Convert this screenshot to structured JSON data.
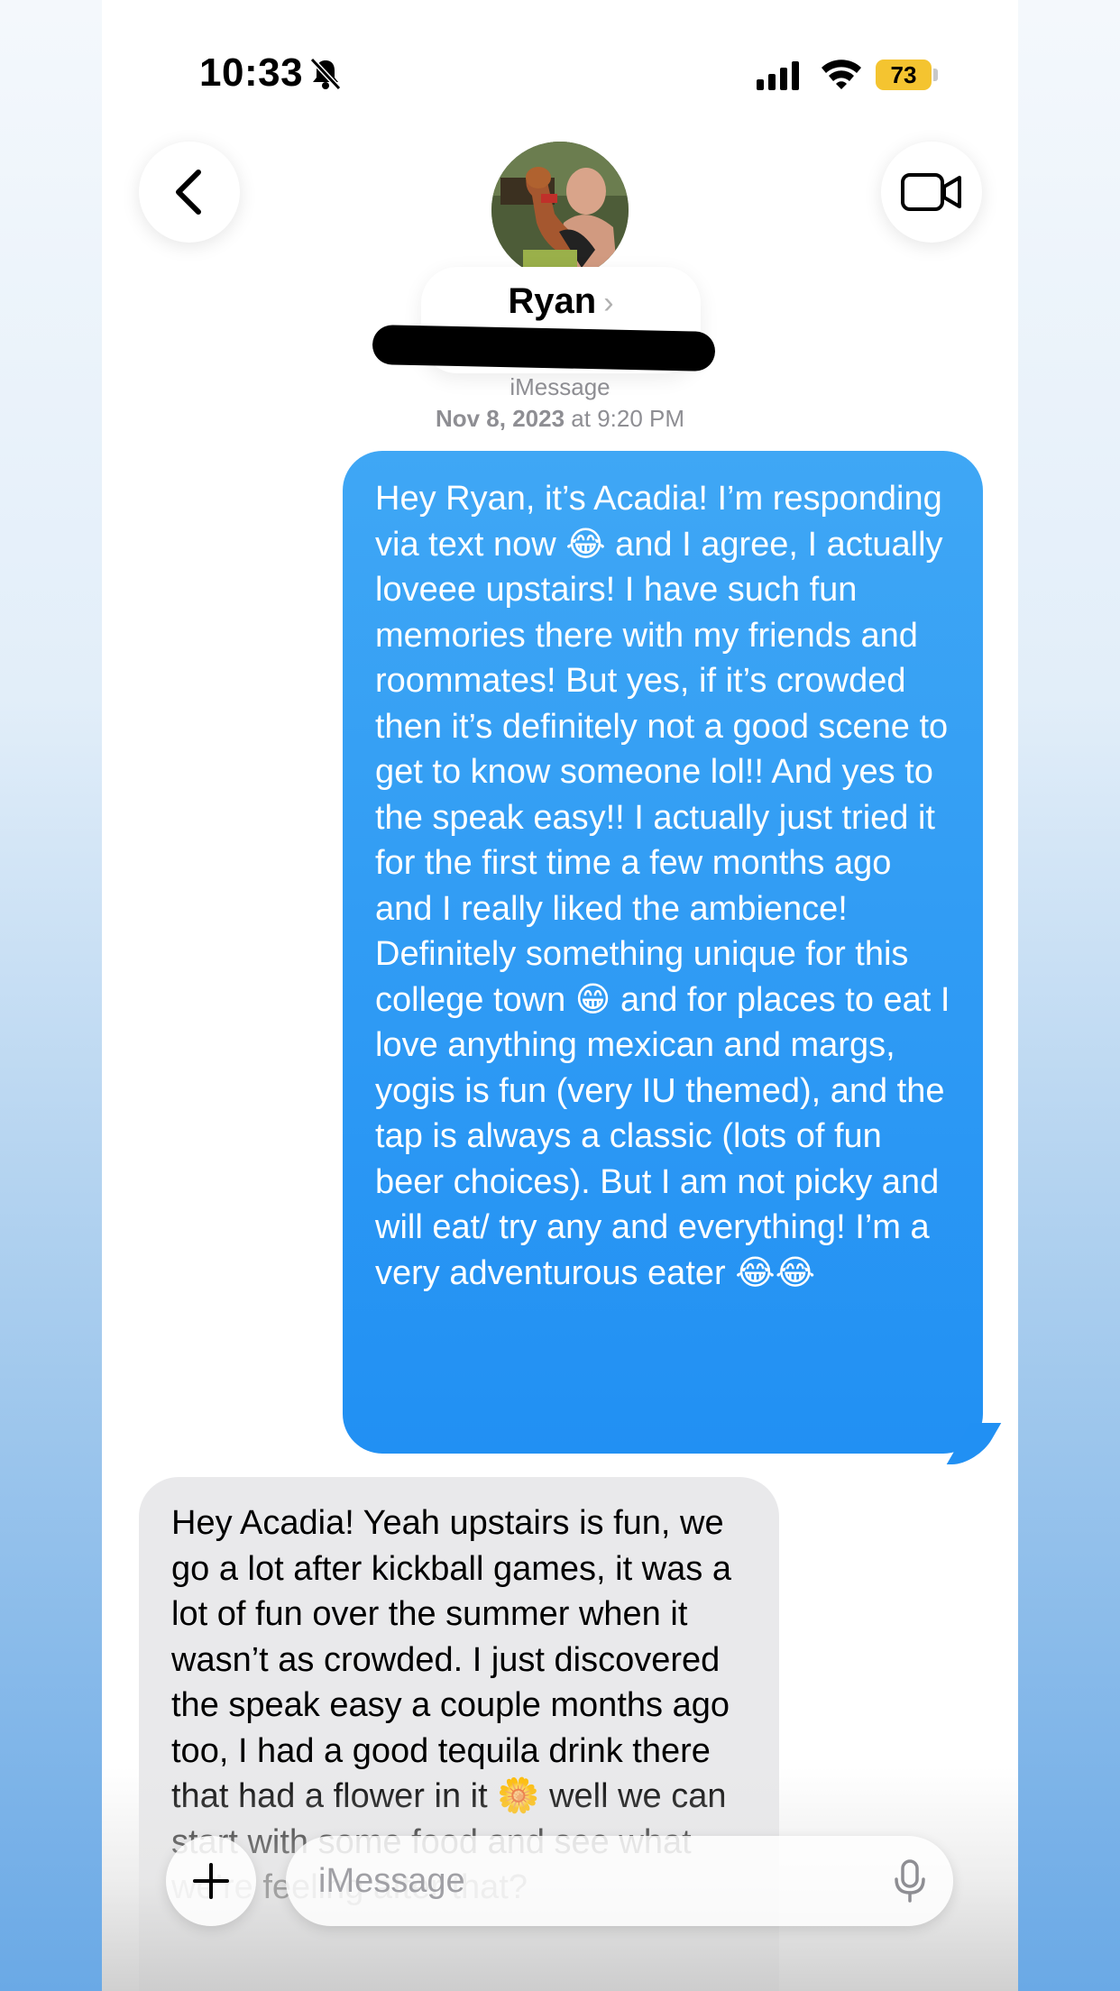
{
  "status_bar": {
    "time": "10:33",
    "battery": "73",
    "icons": [
      "bell-slash-icon",
      "cellular-signal-icon",
      "wifi-icon",
      "battery-icon"
    ]
  },
  "header": {
    "back_icon": "chevron-left-icon",
    "video_icon": "video-camera-icon",
    "contact_name": "Ryan",
    "contact_chevron": "›",
    "service": "iMessage",
    "date": "Nov 8, 2023",
    "time_prefix": " at ",
    "time": "9:20 PM"
  },
  "messages": [
    {
      "direction": "outgoing",
      "text": "Hey Ryan, it’s Acadia! I’m responding via text now 😂 and I agree, I actually loveee upstairs! I have such fun memories there with my friends and roommates! But yes, if it’s crowded then it’s definitely not a good scene to get to know someone lol!! And yes to the speak easy!! I actually just tried it for the first time a few months ago and I really liked the ambience! Definitely something unique for this college town 😁 and for places to eat I love anything mexican and margs, yogis is fun (very IU themed), and the tap is always a classic (lots of fun beer choices). But I am not picky and will eat/ try any and everything! I’m a very adventurous eater 😂😂"
    },
    {
      "direction": "incoming",
      "text": "Hey Acadia! Yeah upstairs is fun, we go a lot after kickball games, it was a lot of fun over the summer when it wasn’t as crowded. I just discovered the speak easy a couple months ago too, I had a good tequila drink there that had a flower in it 🌼 well we can start with some food and see what we’re feeling after that?"
    }
  ],
  "composer": {
    "add_icon": "plus-icon",
    "placeholder": "iMessage",
    "mic_icon": "microphone-icon"
  }
}
